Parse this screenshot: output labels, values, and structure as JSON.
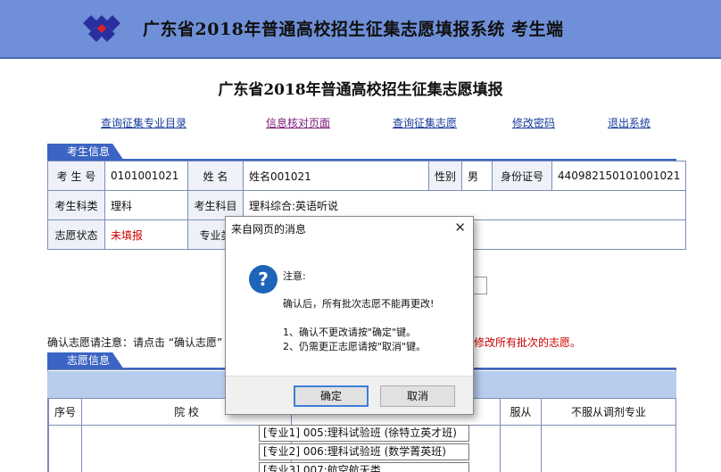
{
  "banner": {
    "title": "广东省2018年普通高校招生征集志愿填报系统  考生端"
  },
  "page": {
    "title": "广东省2018年普通高校招生征集志愿填报"
  },
  "nav": [
    {
      "label": "查询征集专业目录"
    },
    {
      "label": "信息核对页面"
    },
    {
      "label": "查询征集志愿"
    },
    {
      "label": "修改密码"
    },
    {
      "label": "退出系统"
    }
  ],
  "student_section": {
    "tab": "考生信息"
  },
  "student": {
    "exam_no_label": "考 生 号",
    "exam_no": "0101001021",
    "name_label": "姓    名",
    "name": "姓名001021",
    "gender_label": "性别",
    "gender": "男",
    "id_label": "身份证号",
    "id": "440982150101001021",
    "category_label": "考生科类",
    "category": "理科",
    "subjects_label": "考生科目",
    "subjects": "理科综合:英语听说",
    "status_label": "志愿状态",
    "status": "未填报",
    "major_label": "专业类"
  },
  "notice": {
    "text": "确认志愿请注意：请点击 “确认志愿”",
    "red": "修改所有批次的志愿。"
  },
  "volunteer_section": {
    "tab": "志愿信息"
  },
  "volunteer_table": {
    "col_index": "序号",
    "col_school": "院        校",
    "col_obey": "服从",
    "col_not_obey": "不服从调剂专业"
  },
  "majors": [
    "[专业1] 005:理科试验班 (徐特立英才班)",
    "[专业2] 006:理科试验班 (数学菁英班)",
    "[专业3] 007:航空航天类"
  ],
  "dialog": {
    "title": "来自网页的消息",
    "heading": "注意:",
    "line1": "确认后，所有批次志愿不能再更改!",
    "line2": "1、确认不更改请按\"确定\"键。",
    "line3": "2、仍需更正志愿请按\"取消\"键。",
    "ok": "确定",
    "cancel": "取消"
  }
}
